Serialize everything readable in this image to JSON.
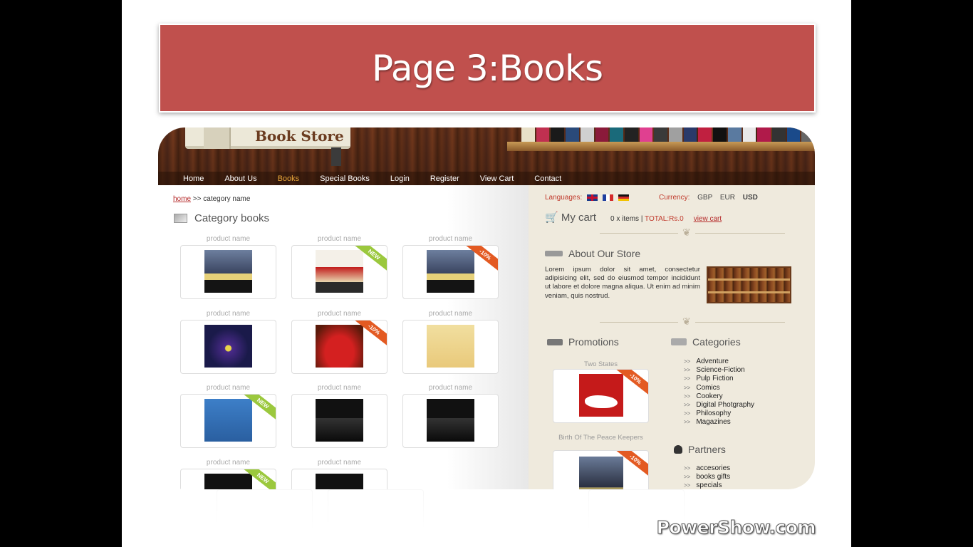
{
  "slide": {
    "title": "Page 3:Books"
  },
  "header": {
    "logo_text": "Book Store",
    "nav": [
      {
        "label": "Home",
        "active": false
      },
      {
        "label": "About Us",
        "active": false
      },
      {
        "label": "Books",
        "active": true
      },
      {
        "label": "Special Books",
        "active": false
      },
      {
        "label": "Login",
        "active": false
      },
      {
        "label": "Register",
        "active": false
      },
      {
        "label": "View Cart",
        "active": false
      },
      {
        "label": "Contact",
        "active": false
      }
    ]
  },
  "main": {
    "breadcrumb": {
      "home": "home",
      "separator": ">>",
      "current": "category name"
    },
    "section_title": "Category books",
    "products": [
      {
        "name": "product name",
        "badge": "",
        "cover": "birth"
      },
      {
        "name": "product name",
        "badge": "NEW",
        "cover": "rich"
      },
      {
        "name": "product name",
        "badge": "-10%",
        "cover": "birth"
      },
      {
        "name": "product name",
        "badge": "",
        "cover": "space"
      },
      {
        "name": "product name",
        "badge": "-10%",
        "cover": "red"
      },
      {
        "name": "product name",
        "badge": "",
        "cover": "food"
      },
      {
        "name": "product name",
        "badge": "NEW",
        "cover": "finance"
      },
      {
        "name": "product name",
        "badge": "",
        "cover": "digital"
      },
      {
        "name": "product name",
        "badge": "",
        "cover": "digital"
      },
      {
        "name": "product name",
        "badge": "NEW",
        "cover": "digital"
      },
      {
        "name": "product name",
        "badge": "",
        "cover": "digital"
      }
    ]
  },
  "sidebar": {
    "languages_label": "Languages:",
    "currency_label": "Currency:",
    "currencies": [
      "GBP",
      "EUR",
      "USD"
    ],
    "selected_currency": "USD",
    "cart": {
      "label": "My cart",
      "items": "0 x items |",
      "total": "TOTAL:Rs.0",
      "view_link": "view cart"
    },
    "about": {
      "title": "About Our Store",
      "text": "Lorem ipsum dolor sit amet, consectetur adipisicing elit, sed do eiusmod tempor incididunt ut labore et dolore magna aliqua. Ut enim ad minim veniam, quis nostrud."
    },
    "promotions": {
      "title": "Promotions",
      "items": [
        {
          "name": "Two States",
          "badge": "-10%"
        },
        {
          "name": "Birth Of The Peace Keepers",
          "badge": "-10%"
        }
      ]
    },
    "categories": {
      "title": "Categories",
      "items": [
        "Adventure",
        "Science-Fiction",
        "Pulp Fiction",
        "Comics",
        "Cookery",
        "Digital Photgraphy",
        "Philosophy",
        "Magazines"
      ]
    },
    "partners": {
      "title": "Partners",
      "items": [
        "accesories",
        "books gifts",
        "specials"
      ]
    }
  },
  "watermark": "PowerShow.com"
}
